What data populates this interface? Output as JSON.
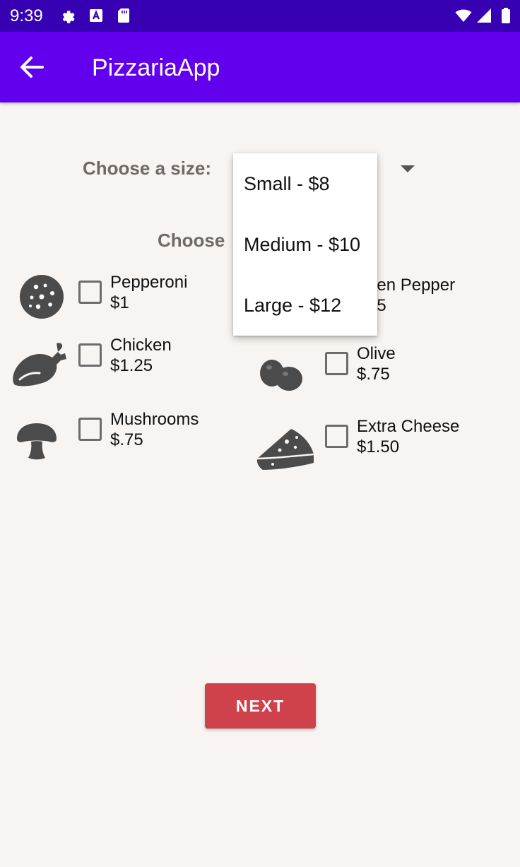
{
  "status_bar": {
    "time": "9:39",
    "icons": [
      "gear-icon",
      "a-badge-icon",
      "sd-card-icon",
      "wifi-icon",
      "signal-icon",
      "battery-icon"
    ]
  },
  "app_bar": {
    "title": "PizzariaApp",
    "back_icon": "arrow-left-icon"
  },
  "size": {
    "label": "Choose a size:",
    "options": [
      "Small - $8",
      "Medium - $10",
      "Large - $12"
    ]
  },
  "toppings": {
    "label": "Choose your toppings:",
    "visible_label_part": "Choose ",
    "items": [
      {
        "name": "Pepperoni",
        "price": "$1",
        "icon": "pepperoni-icon"
      },
      {
        "name": "Green Pepper",
        "price": "$.75",
        "visible_name": "een Pepper",
        "visible_price": "75",
        "icon": "green-pepper-icon"
      },
      {
        "name": "Chicken",
        "price": "$1.25",
        "icon": "chicken-leg-icon"
      },
      {
        "name": "Olive",
        "price": "$.75",
        "icon": "olive-icon"
      },
      {
        "name": "Mushrooms",
        "price": "$.75",
        "icon": "mushroom-icon"
      },
      {
        "name": "Extra Cheese",
        "price": "$1.50",
        "icon": "cheese-icon"
      }
    ]
  },
  "actions": {
    "next_label": "NEXT"
  },
  "colors": {
    "status_bar": "#3700b3",
    "app_bar": "#6200ee",
    "background": "#f8f4f1",
    "button": "#cf414b",
    "icon_gray": "#4b4b4b"
  }
}
